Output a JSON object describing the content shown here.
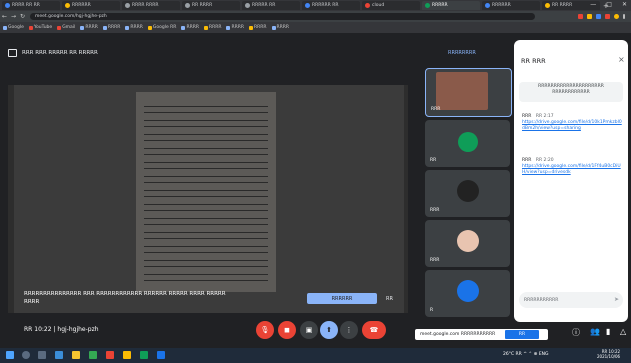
{
  "browser": {
    "tabs": [
      {
        "label": "RRRR RR RR",
        "color": "#4285f4"
      },
      {
        "label": "RRRRRR",
        "color": "#fbbc04"
      },
      {
        "label": "RRRR RRRR",
        "color": "#9aa0a6"
      },
      {
        "label": "RR RRRR",
        "color": "#9aa0a6"
      },
      {
        "label": "RRRRR RR",
        "color": "#9aa0a6"
      },
      {
        "label": "RRRRRR RR",
        "color": "#4285f4"
      },
      {
        "label": "cloud",
        "color": "#ea4335"
      },
      {
        "label": "RRRRR",
        "color": "#0f9d58"
      },
      {
        "label": "RRRRRR",
        "color": "#4285f4"
      },
      {
        "label": "RR RRRR",
        "color": "#fbbc04"
      }
    ],
    "new_tab": "+",
    "url": "meet.google.com/hgj-hgjhe-pzh",
    "window_controls": [
      "—",
      "□",
      "✕"
    ]
  },
  "bookmarks": [
    "Google",
    "YouTube",
    "Gmail",
    "RRRR",
    "RRRR",
    "RRRR",
    "Google RR",
    "RRRR",
    "RRRR",
    "RRRR",
    "RRRR",
    "RRRR"
  ],
  "presentation": {
    "title": "RRR RRR RRRRR RR RRRRR",
    "stop_label": "RRRRRRRR",
    "caption": "RRRRRRRRRRRRRRR RRR RRRRRRRRRRRR RRRRRR RRRRR RRRR RRRRR",
    "caption_line2": "RRRR",
    "caption_button": "RRRRRR",
    "caption_close": "RR"
  },
  "participants": [
    {
      "name": "RRR",
      "avatar_color": "#c0504d"
    },
    {
      "name": "RR",
      "avatar_color": "#0f9d58"
    },
    {
      "name": "RRR",
      "avatar_color": "#222222"
    },
    {
      "name": "RRR",
      "avatar_color": "#e8c4b0"
    },
    {
      "name": "R",
      "avatar_color": "#1a73e8"
    }
  ],
  "chat": {
    "title": "RR RRR",
    "notice": "RRRRRRRRRRRRRRRRRRRRR RRRRRRRRRRRR",
    "messages": [
      {
        "who": "RRR",
        "time": "RR 2:17",
        "link": "https://drive.google.com/file/d/10k1Pmkzbl0dBm2h/view?usp=sharing"
      },
      {
        "who": "RRR",
        "time": "RR 2:20",
        "link": "https://drive.google.com/file/d/1Ff4uB0cDiUH/view?usp=drivesdk"
      }
    ],
    "input_placeholder": "RRRRRRRRRRR"
  },
  "controls": {
    "clock": "RR 10:22",
    "meeting_code": "hgj-hgjhe-pzh",
    "notification": "meet.google.com RRRRRRRRRRR",
    "notification_action": "RR"
  },
  "taskbar": {
    "tray": "26°C  RR  ^ ⌃ ⊕ ENG",
    "time": "RR 10:22",
    "date": "2021/10/06"
  }
}
